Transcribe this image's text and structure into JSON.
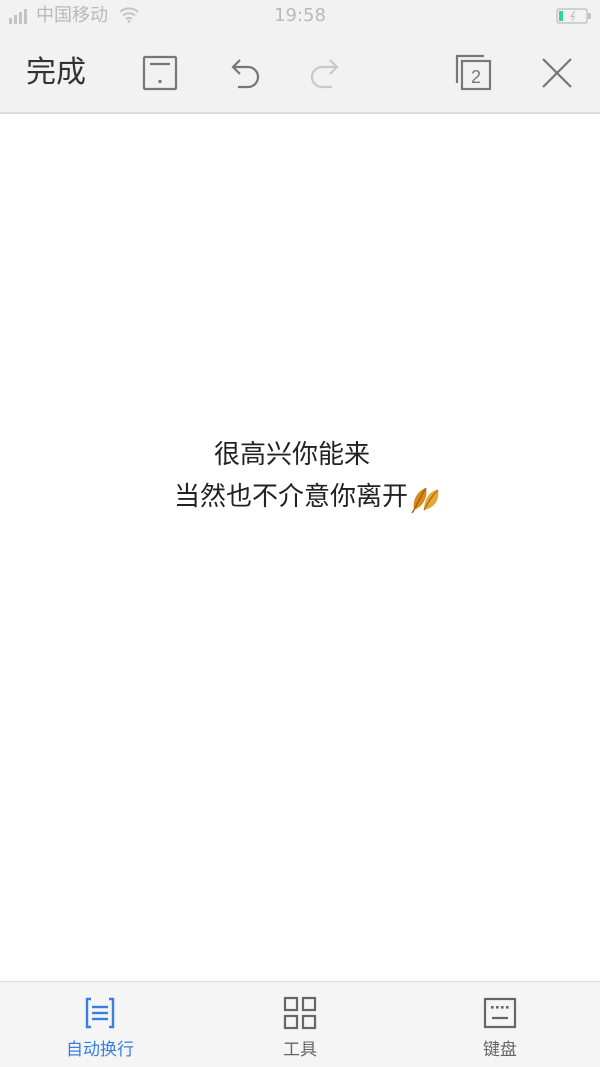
{
  "status_bar": {
    "carrier": "中国移动",
    "time": "19:58"
  },
  "toolbar": {
    "done_label": "完成",
    "page_count": "2"
  },
  "content": {
    "lines": [
      "很高兴你能来",
      "当然也不介意你离开"
    ]
  },
  "bottom_bar": {
    "items": [
      {
        "label": "自动换行",
        "icon": "auto-wrap-icon",
        "active": true
      },
      {
        "label": "工具",
        "icon": "grid-icon",
        "active": false
      },
      {
        "label": "键盘",
        "icon": "keyboard-icon",
        "active": false
      }
    ]
  },
  "colors": {
    "accent": "#3a7ee4",
    "icon_gray": "#777777",
    "disabled_gray": "#c8c8c8",
    "battery_green": "#2fd3a0"
  }
}
